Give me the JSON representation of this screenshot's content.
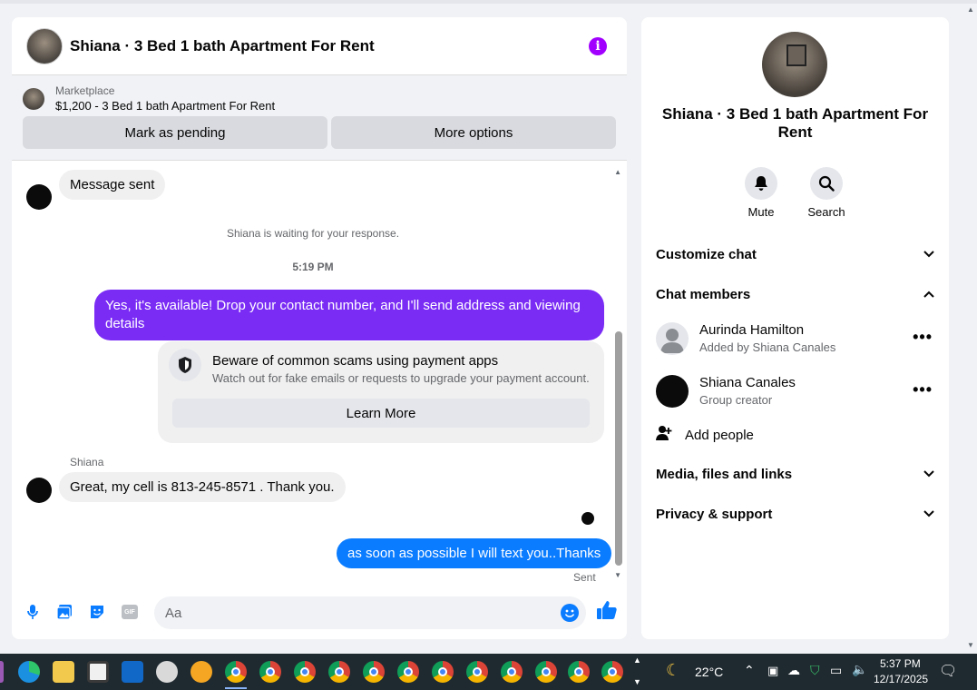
{
  "chat": {
    "title": "Shiana · 3 Bed 1 bath Apartment For Rent",
    "marketplace_label": "Marketplace",
    "marketplace_item": "$1,200 - 3 Bed 1 bath Apartment For Rent",
    "mark_pending": "Mark as pending",
    "more_options": "More options"
  },
  "messages": {
    "msg_sent": "Message sent",
    "waiting": "Shiana is waiting for your response.",
    "time": "5:19 PM",
    "reply1": "Yes, it's available! Drop your contact number, and I'll send address and viewing details",
    "scam_title": "Beware of common scams using payment apps",
    "scam_sub": "Watch out for fake emails or requests to upgrade your payment account.",
    "learn_more": "Learn More",
    "sender": "Shiana",
    "incoming": "Great, my cell is 813-245-8571 . Thank you.",
    "reply2": "as soon as possible I will text you..Thanks",
    "sent": "Sent"
  },
  "composer": {
    "placeholder": "Aa",
    "gif": "GIF"
  },
  "info": {
    "title": "Shiana · 3 Bed 1 bath Apartment For Rent",
    "mute": "Mute",
    "search": "Search",
    "customize": "Customize chat",
    "members_heading": "Chat members",
    "members": [
      {
        "name": "Aurinda Hamilton",
        "sub": "Added by Shiana Canales"
      },
      {
        "name": "Shiana Canales",
        "sub": "Group creator"
      }
    ],
    "add_people": "Add people",
    "media": "Media, files and links",
    "privacy": "Privacy & support"
  },
  "taskbar": {
    "weather": "22°C",
    "time": "5:37 PM",
    "date": "12/17/2025"
  },
  "colors": {
    "purple_bubble": "#7a2cf5",
    "blue_bubble": "#0a7cff",
    "accent_info": "#a100ff"
  }
}
